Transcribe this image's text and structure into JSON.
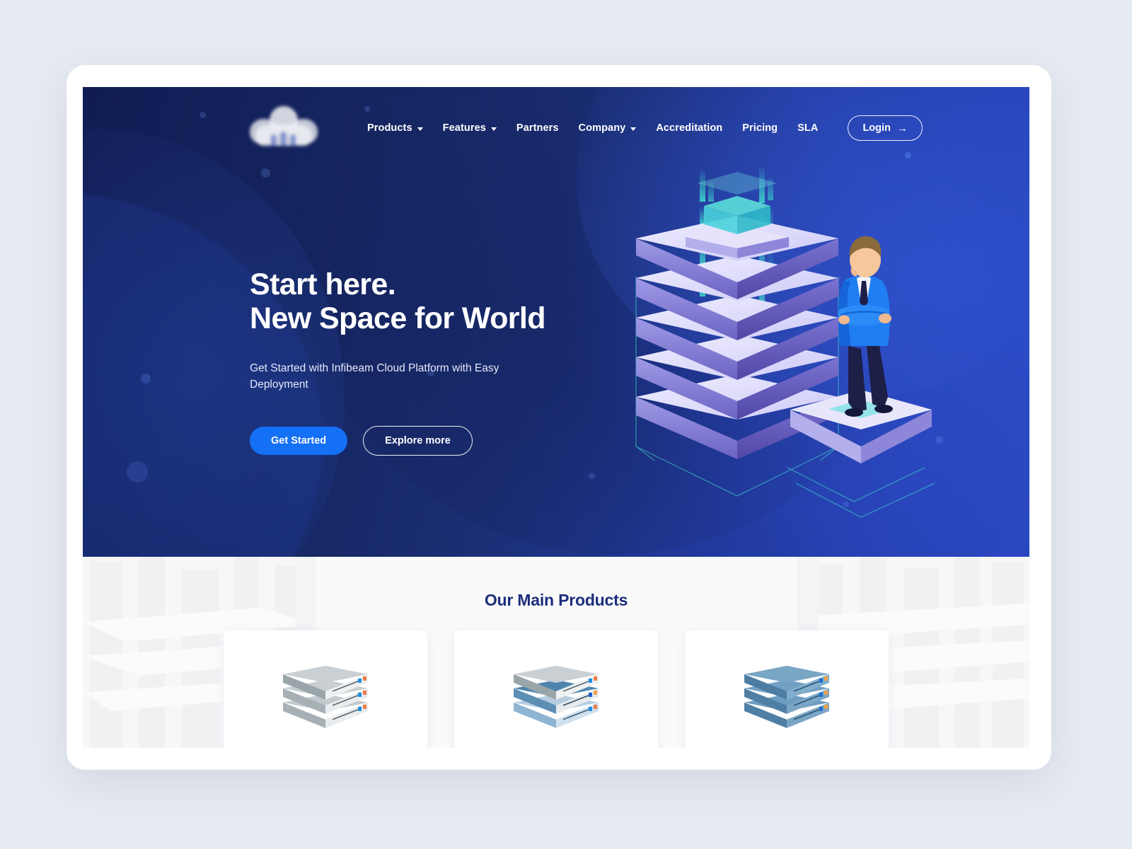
{
  "brand": {
    "logo_alt": "cloud-crown-logo"
  },
  "nav": {
    "items": [
      {
        "label": "Products",
        "has_dropdown": true
      },
      {
        "label": "Features",
        "has_dropdown": true
      },
      {
        "label": "Partners",
        "has_dropdown": false
      },
      {
        "label": "Company",
        "has_dropdown": true
      },
      {
        "label": "Accreditation",
        "has_dropdown": false
      },
      {
        "label": "Pricing",
        "has_dropdown": false
      },
      {
        "label": "SLA",
        "has_dropdown": false
      }
    ],
    "login_label": "Login",
    "login_arrow": "→"
  },
  "hero": {
    "heading_line1": "Start here.",
    "heading_line2": "New Space for World",
    "subtext": "Get Started with Infibeam Cloud Platform with Easy Deployment",
    "primary_cta": "Get Started",
    "secondary_cta": "Explore more"
  },
  "products": {
    "title": "Our Main Products",
    "cards": [
      {
        "icon": "server-stack-gray"
      },
      {
        "icon": "server-stack-gray-blue"
      },
      {
        "icon": "server-stack-blue"
      }
    ]
  },
  "colors": {
    "page_bg": "#e6eaf2",
    "frame": "#ffffff",
    "hero_dark": "#111c54",
    "hero_light": "#2a47c0",
    "accent_blue": "#1470f5",
    "title_navy": "#1b2e7a",
    "section_bg": "#f3f4f6",
    "teal": "#3fd8d0"
  }
}
